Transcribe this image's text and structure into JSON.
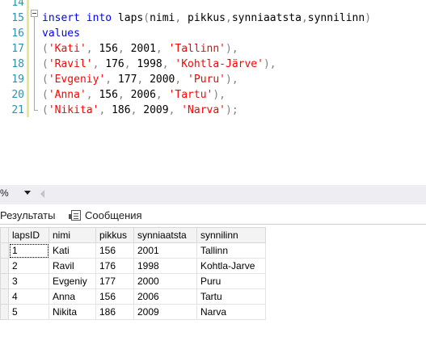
{
  "editor": {
    "line_numbers": [
      "14",
      "15",
      "16",
      "17",
      "18",
      "19",
      "20",
      "21"
    ],
    "lines": [
      [
        {
          "t": "insert",
          "c": "kw"
        },
        {
          "t": " ",
          "c": ""
        },
        {
          "t": "into",
          "c": "kw"
        },
        {
          "t": " laps",
          "c": ""
        },
        {
          "t": "(",
          "c": "punc"
        },
        {
          "t": "nimi",
          "c": ""
        },
        {
          "t": ",",
          "c": "punc"
        },
        {
          "t": " pikkus",
          "c": ""
        },
        {
          "t": ",",
          "c": "punc"
        },
        {
          "t": "synniaatsta",
          "c": ""
        },
        {
          "t": ",",
          "c": "punc"
        },
        {
          "t": "synnilinn",
          "c": ""
        },
        {
          "t": ")",
          "c": "punc"
        }
      ],
      [
        {
          "t": "values",
          "c": "kw"
        }
      ],
      [
        {
          "t": "(",
          "c": "punc"
        },
        {
          "t": "'Kati'",
          "c": "str"
        },
        {
          "t": ",",
          "c": "punc"
        },
        {
          "t": " 156",
          "c": ""
        },
        {
          "t": ",",
          "c": "punc"
        },
        {
          "t": " 2001",
          "c": ""
        },
        {
          "t": ",",
          "c": "punc"
        },
        {
          "t": " ",
          "c": ""
        },
        {
          "t": "'Tallinn'",
          "c": "str"
        },
        {
          "t": "),",
          "c": "punc"
        }
      ],
      [
        {
          "t": "(",
          "c": "punc"
        },
        {
          "t": "'Ravil'",
          "c": "str"
        },
        {
          "t": ",",
          "c": "punc"
        },
        {
          "t": " 176",
          "c": ""
        },
        {
          "t": ",",
          "c": "punc"
        },
        {
          "t": " 1998",
          "c": ""
        },
        {
          "t": ",",
          "c": "punc"
        },
        {
          "t": " ",
          "c": ""
        },
        {
          "t": "'Kohtla-Järve'",
          "c": "str"
        },
        {
          "t": "),",
          "c": "punc"
        }
      ],
      [
        {
          "t": "(",
          "c": "punc"
        },
        {
          "t": "'Evgeniy'",
          "c": "str"
        },
        {
          "t": ",",
          "c": "punc"
        },
        {
          "t": " 177",
          "c": ""
        },
        {
          "t": ",",
          "c": "punc"
        },
        {
          "t": " 2000",
          "c": ""
        },
        {
          "t": ",",
          "c": "punc"
        },
        {
          "t": " ",
          "c": ""
        },
        {
          "t": "'Puru'",
          "c": "str"
        },
        {
          "t": "),",
          "c": "punc"
        }
      ],
      [
        {
          "t": "(",
          "c": "punc"
        },
        {
          "t": "'Anna'",
          "c": "str"
        },
        {
          "t": ",",
          "c": "punc"
        },
        {
          "t": " 156",
          "c": ""
        },
        {
          "t": ",",
          "c": "punc"
        },
        {
          "t": " 2006",
          "c": ""
        },
        {
          "t": ",",
          "c": "punc"
        },
        {
          "t": " ",
          "c": ""
        },
        {
          "t": "'Tartu'",
          "c": "str"
        },
        {
          "t": "),",
          "c": "punc"
        }
      ],
      [
        {
          "t": "(",
          "c": "punc"
        },
        {
          "t": "'Nikita'",
          "c": "str"
        },
        {
          "t": ",",
          "c": "punc"
        },
        {
          "t": " 186",
          "c": ""
        },
        {
          "t": ",",
          "c": "punc"
        },
        {
          "t": " 2009",
          "c": ""
        },
        {
          "t": ",",
          "c": "punc"
        },
        {
          "t": " ",
          "c": ""
        },
        {
          "t": "'Narva'",
          "c": "str"
        },
        {
          "t": ");",
          "c": "punc"
        }
      ]
    ]
  },
  "status": {
    "zoom_label": "%"
  },
  "tabs": {
    "results_label": "Результаты",
    "messages_label": "Сообщения",
    "messages_icon": "messages-icon"
  },
  "results": {
    "columns": [
      "lapsID",
      "nimi",
      "pikkus",
      "synniaatsta",
      "synnilinn"
    ],
    "rows": [
      [
        "1",
        "Kati",
        "156",
        "2001",
        "Tallinn"
      ],
      [
        "2",
        "Ravil",
        "176",
        "1998",
        "Kohtla-Jarve"
      ],
      [
        "3",
        "Evgeniy",
        "177",
        "2000",
        "Puru"
      ],
      [
        "4",
        "Anna",
        "156",
        "2006",
        "Tartu"
      ],
      [
        "5",
        "Nikita",
        "186",
        "2009",
        "Narva"
      ]
    ]
  },
  "colors": {
    "keyword": "#0000ff",
    "string": "#ff0000",
    "line_number": "#2b91af",
    "change_bar": "#eee58a"
  }
}
